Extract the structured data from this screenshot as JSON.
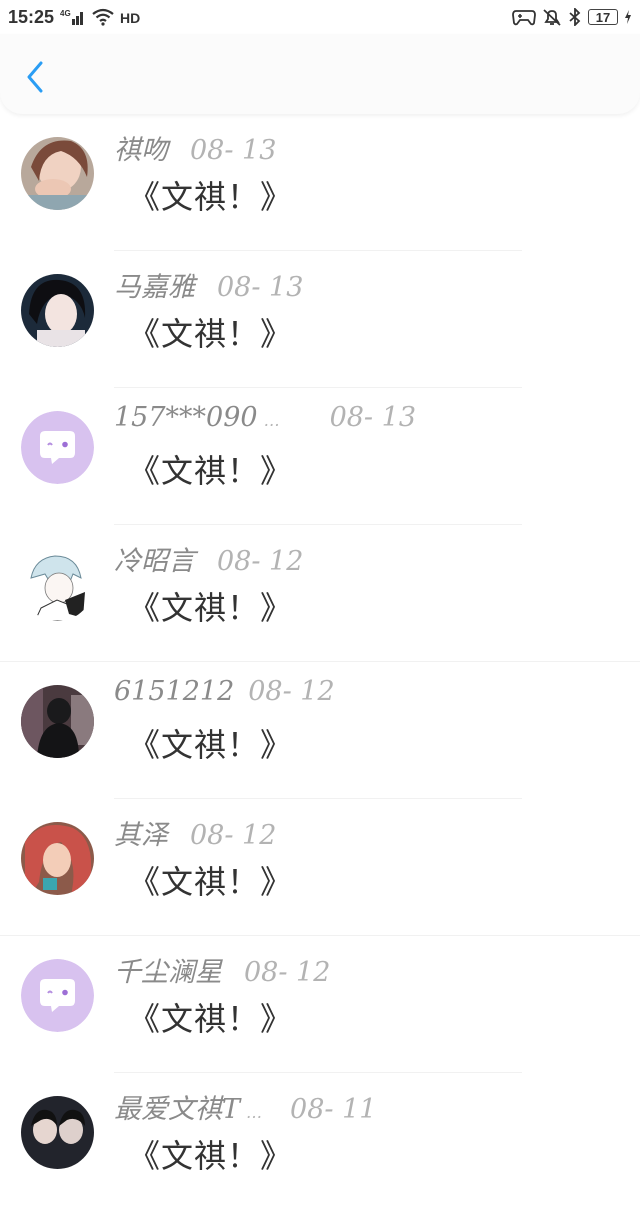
{
  "status_bar": {
    "time": "15:25",
    "network": "4G",
    "hd_label": "HD",
    "battery": "17"
  },
  "nav": {
    "back_icon": "chevron-left-icon"
  },
  "colors": {
    "accent": "#2a9df4",
    "placeholder_avatar": "#d8c2ef"
  },
  "comments": [
    {
      "name": "祺吻",
      "date": "08- 13",
      "message": "《文祺！》",
      "avatar": "photo-girl"
    },
    {
      "name": "马嘉雅",
      "date": "08- 13",
      "message": "《文祺！》",
      "avatar": "photo-girl-dark"
    },
    {
      "name": "157***090",
      "ellipsis": "…",
      "date": "08- 13",
      "message": "《文祺！》",
      "avatar": "default-chat"
    },
    {
      "name": "冷昭言",
      "date": "08- 12",
      "message": "《文祺！》",
      "avatar": "anime-sketch"
    },
    {
      "name": "6151212",
      "date": "08- 12",
      "message": "《文祺！》",
      "avatar": "photo-dark"
    },
    {
      "name": "其泽",
      "date": "08- 12",
      "message": "《文祺！》",
      "avatar": "photo-red"
    },
    {
      "name": "千尘澜星",
      "date": "08- 12",
      "message": "《文祺！》",
      "avatar": "default-chat"
    },
    {
      "name": "最爱文祺T",
      "ellipsis": "…",
      "date": "08- 11",
      "message": "《文祺！》",
      "avatar": "photo-couple"
    }
  ]
}
